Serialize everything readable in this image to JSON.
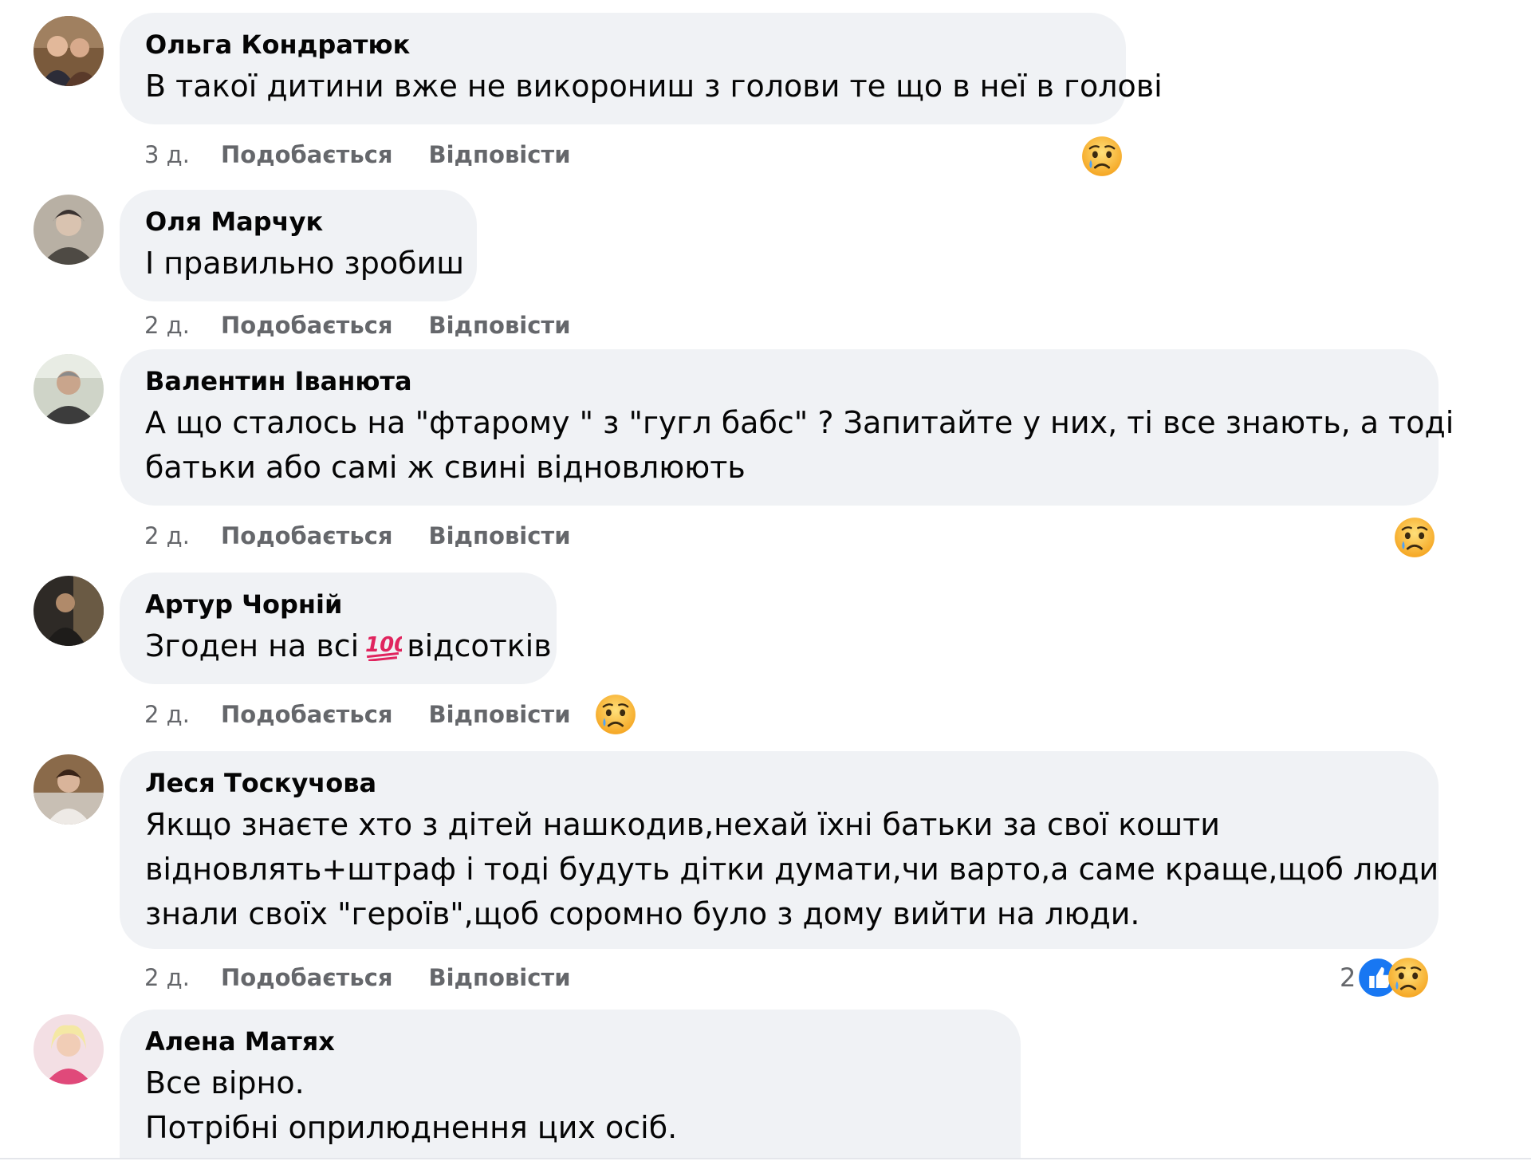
{
  "comments": [
    {
      "author": "Ольга Кондратюк",
      "text": [
        "В такої дитини вже не викорониш з голови те що в неї в голові"
      ],
      "time": "3 д.",
      "like_label": "Подобається",
      "reply_label": "Відповісти",
      "reactions": [
        "sad-reaction"
      ],
      "reaction_count": ""
    },
    {
      "author": "Оля Марчук",
      "text": [
        "І правильно зробиш"
      ],
      "time": "2 д.",
      "like_label": "Подобається",
      "reply_label": "Відповісти",
      "reactions": [],
      "reaction_count": ""
    },
    {
      "author": "Валентин Іванюта",
      "text": [
        "А що сталось на \"фтарому \" з \"гугл бабс\" ? Запитайте у них, ті все знають, а тоді",
        "батьки або самі ж свині відновлюють"
      ],
      "time": "2 д.",
      "like_label": "Подобається",
      "reply_label": "Відповісти",
      "reactions": [
        "sad-reaction"
      ],
      "reaction_count": ""
    },
    {
      "author": "Артур Чорній",
      "text_before": "Згоден на всі",
      "text_emoji": "hundred-points-emoji",
      "text_after": "відсотків",
      "time": "2 д.",
      "like_label": "Подобається",
      "reply_label": "Відповісти",
      "reactions": [
        "sad-reaction"
      ],
      "reaction_count": ""
    },
    {
      "author": "Леся Тоскучова",
      "text": [
        "Якщо знаєте хто з дітей нашкодив,нехай їхні батьки за свої кошти",
        "відновлять+штраф і тоді будуть дітки думати,чи варто,а саме краще,щоб люди",
        "знали своїх \"героїв\",щоб соромно було з дому вийти на люди."
      ],
      "time": "2 д.",
      "like_label": "Подобається",
      "reply_label": "Відповісти",
      "reactions": [
        "like-reaction",
        "sad-reaction"
      ],
      "reaction_count": "2"
    },
    {
      "author": "Алена Матях",
      "text": [
        "Все вірно.",
        "Потрібні оприлюднення цих осіб."
      ],
      "time": "",
      "like_label": "",
      "reply_label": "",
      "reactions": [],
      "reaction_count": ""
    }
  ],
  "colors": {
    "bubble": "#f0f2f5",
    "meta_text": "#65676b",
    "like_blue": "#1877f2",
    "sad_yellow": "#f7b125"
  }
}
